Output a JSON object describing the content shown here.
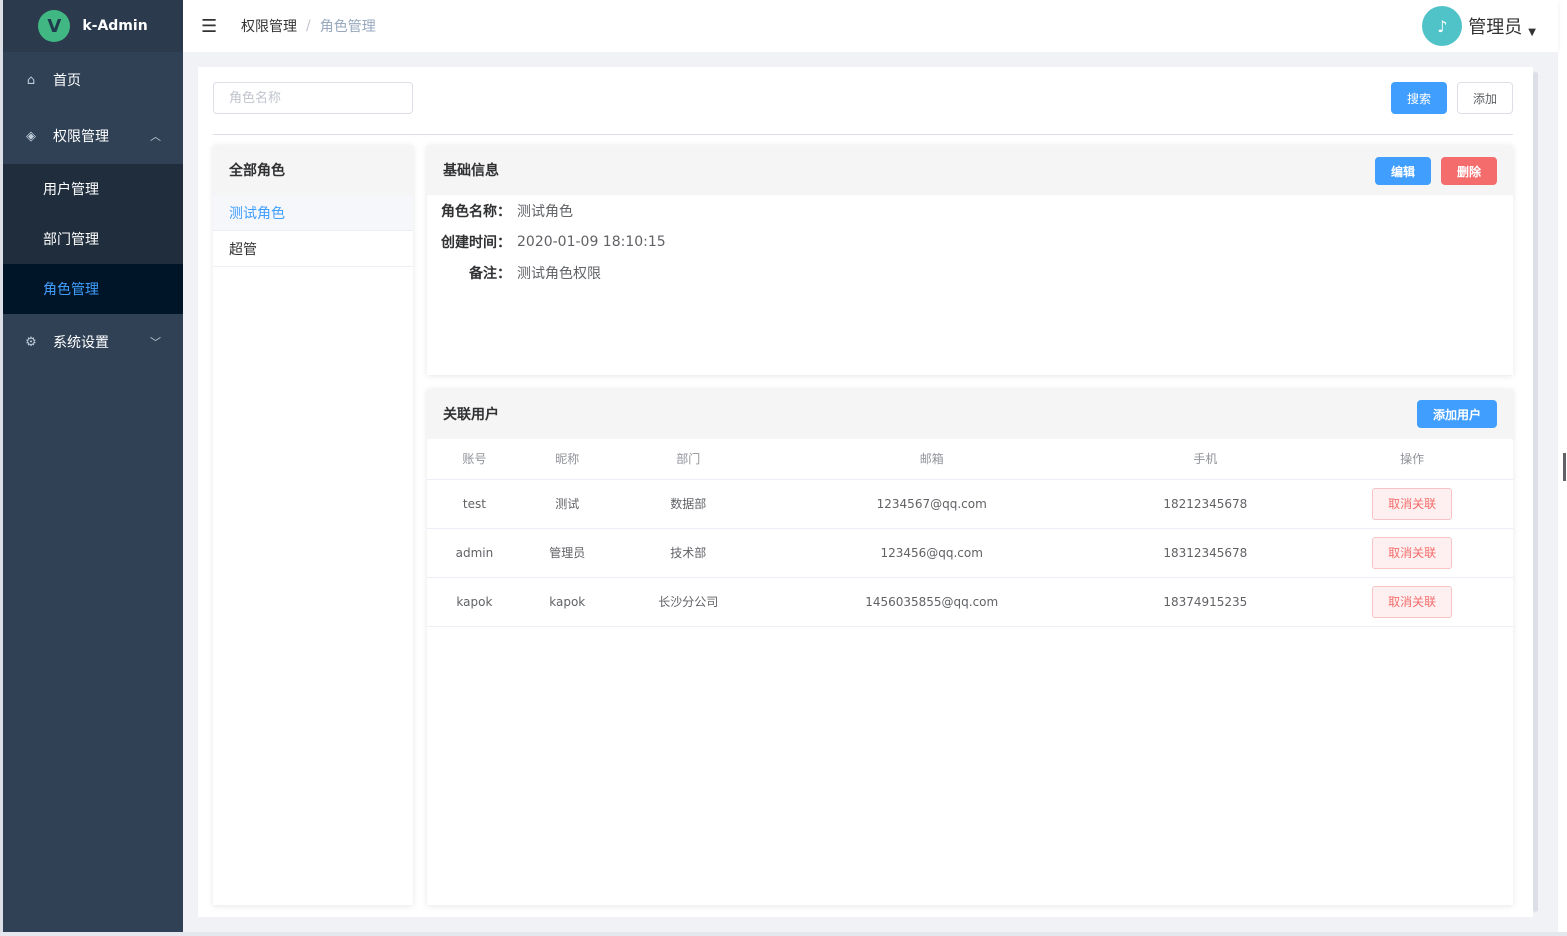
{
  "app": {
    "logo_letter": "V",
    "name": "k-Admin"
  },
  "sidebar": {
    "items": [
      {
        "label": "首页",
        "icon": "home-icon"
      },
      {
        "label": "权限管理",
        "icon": "shield-icon",
        "expanded": true,
        "children": [
          {
            "label": "用户管理"
          },
          {
            "label": "部门管理"
          },
          {
            "label": "角色管理",
            "active": true
          }
        ]
      },
      {
        "label": "系统设置",
        "icon": "gear-icon",
        "expanded": false
      }
    ]
  },
  "header": {
    "breadcrumb": [
      "权限管理",
      "角色管理"
    ],
    "breadcrumb_sep": "/",
    "user_name": "管理员"
  },
  "toolbar": {
    "search_placeholder": "角色名称",
    "search_value": "",
    "search_label": "搜索",
    "add_label": "添加"
  },
  "roles": {
    "title": "全部角色",
    "items": [
      {
        "name": "测试角色",
        "active": true
      },
      {
        "name": "超管",
        "active": false
      }
    ]
  },
  "info": {
    "title": "基础信息",
    "edit_label": "编辑",
    "delete_label": "删除",
    "fields": [
      {
        "label": "角色名称：",
        "value": "测试角色"
      },
      {
        "label": "创建时间：",
        "value": "2020-01-09 18:10:15"
      },
      {
        "label": "备注：",
        "value": "测试角色权限"
      }
    ]
  },
  "users": {
    "title": "关联用户",
    "add_label": "添加用户",
    "columns": [
      "账号",
      "昵称",
      "部门",
      "邮箱",
      "手机",
      "操作"
    ],
    "action_label": "取消关联",
    "rows": [
      {
        "account": "test",
        "nickname": "测试",
        "dept": "数据部",
        "email": "1234567@qq.com",
        "phone": "18212345678"
      },
      {
        "account": "admin",
        "nickname": "管理员",
        "dept": "技术部",
        "email": "123456@qq.com",
        "phone": "18312345678"
      },
      {
        "account": "kapok",
        "nickname": "kapok",
        "dept": "长沙分公司",
        "email": "1456035855@qq.com",
        "phone": "18374915235"
      }
    ]
  },
  "colors": {
    "sidebar_bg": "#304156",
    "submenu_bg": "#1f2d3d",
    "active_bg": "#001528",
    "primary": "#409eff",
    "danger": "#f56c6c"
  }
}
